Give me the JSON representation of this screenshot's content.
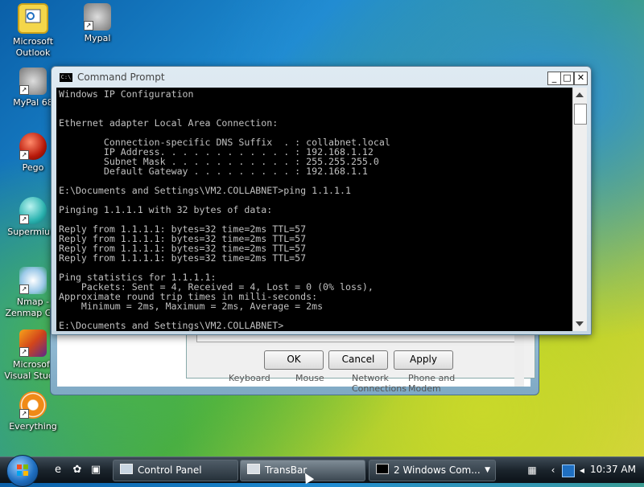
{
  "desktop": {
    "icons": [
      {
        "label": "Microsoft Outlook",
        "icon": "outlook-icon"
      },
      {
        "label": "Mypal",
        "icon": "mypal-icon"
      },
      {
        "label": "MyPal 68",
        "icon": "mypal68-icon"
      },
      {
        "label": "Pego",
        "icon": "pego-icon"
      },
      {
        "label": "Supermium",
        "icon": "supermium-icon"
      },
      {
        "label": "Nmap - Zenmap GUI",
        "icon": "nmap-icon"
      },
      {
        "label": "Microsoft Visual Studio",
        "icon": "visual-studio-icon"
      },
      {
        "label": "Everything",
        "icon": "everything-icon"
      }
    ]
  },
  "control_panel_dialog": {
    "ok_label": "OK",
    "cancel_label": "Cancel",
    "apply_label": "Apply",
    "item_labels": [
      "Keyboard",
      "Mouse",
      "Network Connections",
      "Phone and Modem"
    ]
  },
  "cmd_window": {
    "title": "Command Prompt",
    "icon_text": "C:\\",
    "minimize_glyph": "_",
    "maximize_glyph": "□",
    "close_glyph": "✕",
    "console_text": "Windows IP Configuration\n\n\nEthernet adapter Local Area Connection:\n\n        Connection-specific DNS Suffix  . : collabnet.local\n        IP Address. . . . . . . . . . . . : 192.168.1.12\n        Subnet Mask . . . . . . . . . . . : 255.255.255.0\n        Default Gateway . . . . . . . . . : 192.168.1.1\n\nE:\\Documents and Settings\\VM2.COLLABNET>ping 1.1.1.1\n\nPinging 1.1.1.1 with 32 bytes of data:\n\nReply from 1.1.1.1: bytes=32 time=2ms TTL=57\nReply from 1.1.1.1: bytes=32 time=2ms TTL=57\nReply from 1.1.1.1: bytes=32 time=2ms TTL=57\nReply from 1.1.1.1: bytes=32 time=2ms TTL=57\n\nPing statistics for 1.1.1.1:\n    Packets: Sent = 4, Received = 4, Lost = 0 (0% loss),\nApproximate round trip times in milli-seconds:\n    Minimum = 2ms, Maximum = 2ms, Average = 2ms\n\nE:\\Documents and Settings\\VM2.COLLABNET>"
  },
  "taskbar": {
    "buttons": [
      {
        "label": "Control Panel",
        "icon": "control-panel-icon",
        "active": false
      },
      {
        "label": "TransBar",
        "icon": "transbar-icon",
        "active": true
      },
      {
        "label": "2 Windows Com...",
        "icon": "cmd-icon",
        "active": false
      }
    ],
    "clock": "10:37 AM",
    "quick_launch": [
      "ie-icon",
      "mypal-quick-icon",
      "show-desktop-icon"
    ]
  },
  "colors": {
    "console_bg": "#000000",
    "console_fg": "#c0c0c0",
    "taskbar": "#1b242c"
  }
}
